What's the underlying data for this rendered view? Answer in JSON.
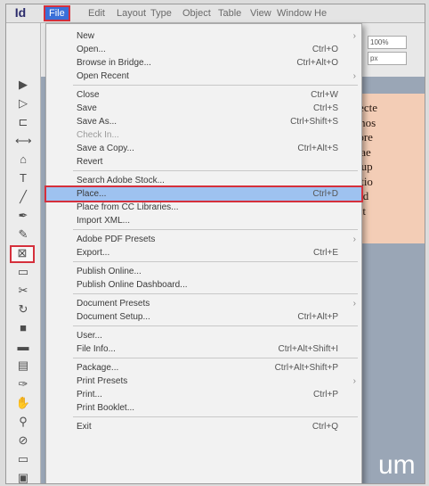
{
  "app": {
    "icon": "Id"
  },
  "menubar": [
    {
      "label": "File",
      "active": true
    },
    {
      "label": "Edit"
    },
    {
      "label": "Layout"
    },
    {
      "label": "Type"
    },
    {
      "label": "Object"
    },
    {
      "label": "Table"
    },
    {
      "label": "View"
    },
    {
      "label": "Window"
    },
    {
      "label": "He"
    }
  ],
  "tools": [
    {
      "name": "selection-tool-icon",
      "glyph": "▶"
    },
    {
      "name": "direct-selection-tool-icon",
      "glyph": "▷"
    },
    {
      "name": "page-tool-icon",
      "glyph": "⊏"
    },
    {
      "name": "gap-tool-icon",
      "glyph": "⟷"
    },
    {
      "name": "content-collector-icon",
      "glyph": "⌂"
    },
    {
      "name": "type-tool-icon",
      "glyph": "T"
    },
    {
      "name": "line-tool-icon",
      "glyph": "╱"
    },
    {
      "name": "pen-tool-icon",
      "glyph": "✒"
    },
    {
      "name": "pencil-tool-icon",
      "glyph": "✎"
    },
    {
      "name": "rectangle-frame-tool-icon",
      "glyph": "⊠",
      "highlight": true
    },
    {
      "name": "rectangle-tool-icon",
      "glyph": "▭"
    },
    {
      "name": "scissors-tool-icon",
      "glyph": "✂"
    },
    {
      "name": "free-transform-tool-icon",
      "glyph": "↻"
    },
    {
      "name": "gradient-swatch-tool-icon",
      "glyph": "■"
    },
    {
      "name": "gradient-feather-tool-icon",
      "glyph": "▬"
    },
    {
      "name": "note-tool-icon",
      "glyph": "▤"
    },
    {
      "name": "eyedropper-tool-icon",
      "glyph": "✑"
    },
    {
      "name": "hand-tool-icon",
      "glyph": "✋"
    },
    {
      "name": "zoom-tool-icon",
      "glyph": "⚲"
    },
    {
      "name": "fill-stroke-icon",
      "glyph": "⊘"
    },
    {
      "name": "formatting-container-icon",
      "glyph": "▭"
    },
    {
      "name": "screen-mode-icon",
      "glyph": "▣"
    }
  ],
  "controlbar": {
    "zoom_field": "100%",
    "ref_field": "px"
  },
  "page_text": [
    "onsecte",
    "ed mos",
    "orpore",
    "berlae",
    "hil lup",
    "oriatio",
    "aut id",
    "endit"
  ],
  "canvas_text": "um",
  "menu": {
    "items": [
      {
        "label": "New",
        "shortcut": "",
        "arrow": true
      },
      {
        "label": "Open...",
        "shortcut": "Ctrl+O"
      },
      {
        "label": "Browse in Bridge...",
        "shortcut": "Ctrl+Alt+O"
      },
      {
        "label": "Open Recent",
        "shortcut": "",
        "arrow": true
      },
      {
        "sep": true
      },
      {
        "label": "Close",
        "shortcut": "Ctrl+W"
      },
      {
        "label": "Save",
        "shortcut": "Ctrl+S"
      },
      {
        "label": "Save As...",
        "shortcut": "Ctrl+Shift+S"
      },
      {
        "label": "Check In...",
        "shortcut": "",
        "disabled": true
      },
      {
        "label": "Save a Copy...",
        "shortcut": "Ctrl+Alt+S"
      },
      {
        "label": "Revert",
        "shortcut": ""
      },
      {
        "sep": true
      },
      {
        "label": "Search Adobe Stock...",
        "shortcut": ""
      },
      {
        "label": "Place...",
        "shortcut": "Ctrl+D",
        "highlight": true
      },
      {
        "label": "Place from CC Libraries...",
        "shortcut": ""
      },
      {
        "label": "Import XML...",
        "shortcut": ""
      },
      {
        "sep": true
      },
      {
        "label": "Adobe PDF Presets",
        "shortcut": "",
        "arrow": true
      },
      {
        "label": "Export...",
        "shortcut": "Ctrl+E"
      },
      {
        "sep": true
      },
      {
        "label": "Publish Online...",
        "shortcut": ""
      },
      {
        "label": "Publish Online Dashboard...",
        "shortcut": ""
      },
      {
        "sep": true
      },
      {
        "label": "Document Presets",
        "shortcut": "",
        "arrow": true
      },
      {
        "label": "Document Setup...",
        "shortcut": "Ctrl+Alt+P"
      },
      {
        "sep": true
      },
      {
        "label": "User...",
        "shortcut": ""
      },
      {
        "label": "File Info...",
        "shortcut": "Ctrl+Alt+Shift+I"
      },
      {
        "sep": true
      },
      {
        "label": "Package...",
        "shortcut": "Ctrl+Alt+Shift+P"
      },
      {
        "label": "Print Presets",
        "shortcut": "",
        "arrow": true
      },
      {
        "label": "Print...",
        "shortcut": "Ctrl+P"
      },
      {
        "label": "Print Booklet...",
        "shortcut": ""
      },
      {
        "sep": true
      },
      {
        "label": "Exit",
        "shortcut": "Ctrl+Q"
      }
    ]
  },
  "colors": {
    "highlight_outline": "#d5303c",
    "menu_highlight": "#9ec2f0",
    "active_menu": "#3a6fd8"
  }
}
